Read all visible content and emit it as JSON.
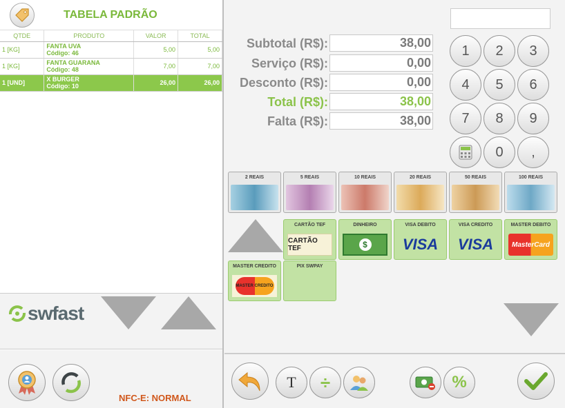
{
  "header": {
    "title": "TABELA PADRÃO"
  },
  "table": {
    "columns": [
      "QTDE",
      "PRODUTO",
      "VALOR",
      "TOTAL"
    ],
    "rows": [
      {
        "qty": "1 [KG]",
        "product": "FANTA UVA",
        "code": "Código: 46",
        "value": "5,00",
        "total": "5,00",
        "selected": false
      },
      {
        "qty": "1 [KG]",
        "product": "FANTA GUARANA",
        "code": "Código: 48",
        "value": "7,00",
        "total": "7,00",
        "selected": false
      },
      {
        "qty": "1 [UND]",
        "product": "X BURGER",
        "code": "Código: 10",
        "value": "26,00",
        "total": "26,00",
        "selected": true
      }
    ]
  },
  "brand": {
    "logo_text": "swfast"
  },
  "status": {
    "nfce": "NFC-E: NORMAL"
  },
  "totals": {
    "subtotal_label": "Subtotal (R$):",
    "subtotal": "38,00",
    "servico_label": "Serviço (R$):",
    "servico": "0,00",
    "desconto_label": "Desconto (R$):",
    "desconto": "0,00",
    "total_label": "Total (R$):",
    "total": "38,00",
    "falta_label": "Falta (R$):",
    "falta": "38,00"
  },
  "keypad": [
    "1",
    "2",
    "3",
    "4",
    "5",
    "6",
    "7",
    "8",
    "9",
    "0",
    ","
  ],
  "bills": [
    {
      "label": "2 REAIS",
      "color": "#7fb6cf"
    },
    {
      "label": "5 REAIS",
      "color": "#c8a0c8"
    },
    {
      "label": "10 REAIS",
      "color": "#d89a8a"
    },
    {
      "label": "20 REAIS",
      "color": "#e6c48a"
    },
    {
      "label": "50 REAIS",
      "color": "#dcb070"
    },
    {
      "label": "100 REAIS",
      "color": "#8cc0d8"
    }
  ],
  "payments": [
    {
      "label": "CARTÃO TEF",
      "mark": "CARTÃO TEF"
    },
    {
      "label": "DINHEIRO",
      "mark": "$"
    },
    {
      "label": "VISA DEBITO",
      "mark": "VISA"
    },
    {
      "label": "VISA CREDITO",
      "mark": "VISA"
    },
    {
      "label": "MASTER DEBITO",
      "mark": "MasterCard"
    },
    {
      "label": "MASTER CREDITO",
      "mark": "MASTER CREDITO"
    },
    {
      "label": "PIX SWPAY",
      "mark": ""
    }
  ],
  "toolbar": {
    "text_tool": "T",
    "divide": "÷",
    "percent": "%"
  },
  "colors": {
    "accent_green": "#8bc34a",
    "selected_row": "#8cc84b",
    "nfce_orange": "#d0571b"
  }
}
